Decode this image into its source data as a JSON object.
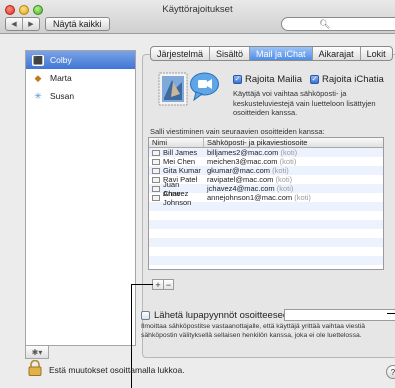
{
  "window": {
    "title": "Käyttörajoitukset"
  },
  "toolbar": {
    "back_glyph": "◀",
    "forward_glyph": "▶",
    "show_all_label": "Näytä kaikki",
    "search_placeholder": "",
    "search_icon": "search-icon"
  },
  "sidebar": {
    "users": [
      {
        "name": "Colby",
        "icon": "user-picture-icon",
        "selected": true
      },
      {
        "name": "Marta",
        "icon": "butterfly-icon",
        "selected": false
      },
      {
        "name": "Susan",
        "icon": "snowflake-icon",
        "selected": false
      }
    ],
    "action_glyph": "✱▾"
  },
  "tabs": [
    {
      "label": "Järjestelmä",
      "active": false
    },
    {
      "label": "Sisältö",
      "active": false
    },
    {
      "label": "Mail ja iChat",
      "active": true
    },
    {
      "label": "Aikarajat",
      "active": false
    },
    {
      "label": "Lokit",
      "active": false
    }
  ],
  "limits": {
    "mail_label": "Rajoita Mailia",
    "mail_checked": true,
    "ichat_label": "Rajoita iChatia",
    "ichat_checked": true,
    "description": "Käyttäjä voi vaihtaa sähköposti- ja keskusteluviestejä vain luetteloon lisättyjen osoitteiden kanssa."
  },
  "allowed": {
    "label": "Salli viestiminen vain seuraavien osoitteiden kanssa:",
    "columns": [
      "Nimi",
      "Sähköposti- ja pikaviestiosoite"
    ],
    "rows": [
      {
        "name": "Bill James",
        "address": "billjames2@mac.com",
        "tag": "(koti)"
      },
      {
        "name": "Mei Chen",
        "address": "meichen3@mac.com",
        "tag": "(koti)"
      },
      {
        "name": "Gita Kumar",
        "address": "gkumar@mac.com",
        "tag": "(koti)"
      },
      {
        "name": "Ravi Patel",
        "address": "ravipatel@mac.com",
        "tag": "(koti)"
      },
      {
        "name": "Juan Chavez",
        "address": "jchavez4@mac.com",
        "tag": "(koti)"
      },
      {
        "name": "Anne Johnson",
        "address": "annejohnson1@mac.com",
        "tag": "(koti)"
      }
    ],
    "add_label": "+",
    "remove_label": "−"
  },
  "approval": {
    "label": "Lähetä lupapyynnöt osoitteeseen:",
    "checked": false,
    "value": "",
    "description": "Ilmoittaa sähköpostitse vastaanottajalle, että käyttäjä yrittää vaihtaa viestiä sähköpostin välityksellä sellaisen henkilön kanssa, joka ei ole luettelossa."
  },
  "footer": {
    "lock_text": "Estä muutokset osoittamalla lukkoa.",
    "help_label": "?"
  }
}
